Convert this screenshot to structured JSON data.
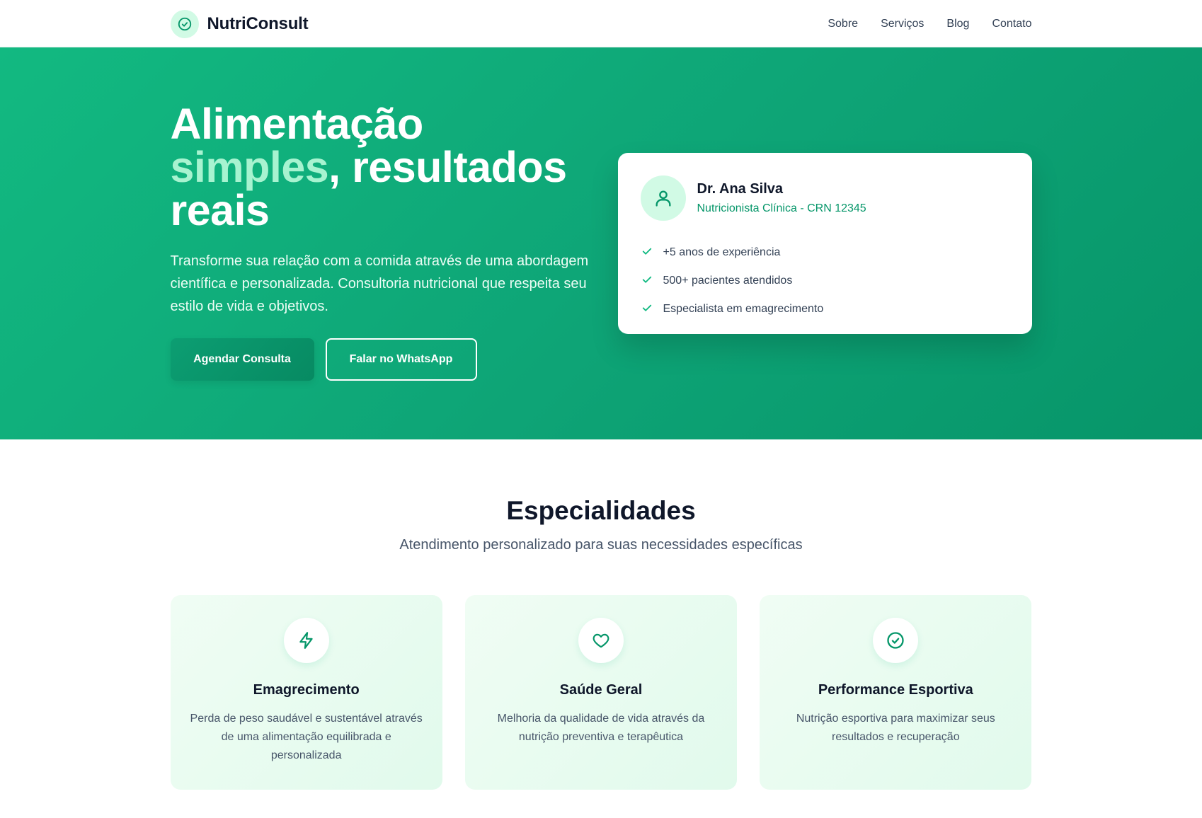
{
  "header": {
    "brand": "NutriConsult",
    "brand_icon": "check-circle-icon",
    "nav": [
      "Sobre",
      "Serviços",
      "Blog",
      "Contato"
    ]
  },
  "hero": {
    "title_line1": "Alimentação",
    "title_accent": "simples",
    "title_rest": ", resultados",
    "title_line3": "reais",
    "description": "Transforme sua relação com a comida através de uma abordagem científica e personalizada. Consultoria nutricional que respeita seu estilo de vida e objetivos.",
    "primary_button": "Agendar Consulta",
    "secondary_button": "Falar no WhatsApp",
    "colors": {
      "gradient_start": "#12b981",
      "gradient_end": "#079569",
      "accent_text": "#a7f3d0"
    }
  },
  "doctor_card": {
    "avatar_icon": "user-icon",
    "name": "Dr. Ana Silva",
    "role": "Nutricionista Clínica - CRN 12345",
    "highlights": [
      "+5 anos de experiência",
      "500+ pacientes atendidos",
      "Especialista em emagrecimento"
    ]
  },
  "specialties": {
    "title": "Especialidades",
    "subtitle": "Atendimento personalizado para suas necessidades específicas",
    "cards": [
      {
        "icon": "lightning-icon",
        "title": "Emagrecimento",
        "description": "Perda de peso saudável e sustentável através de uma alimentação equilibrada e personalizada"
      },
      {
        "icon": "heart-icon",
        "title": "Saúde Geral",
        "description": "Melhoria da qualidade de vida através da nutrição preventiva e terapêutica"
      },
      {
        "icon": "check-circle-icon",
        "title": "Performance Esportiva",
        "description": "Nutrição esportiva para maximizar seus resultados e recuperação"
      }
    ]
  }
}
